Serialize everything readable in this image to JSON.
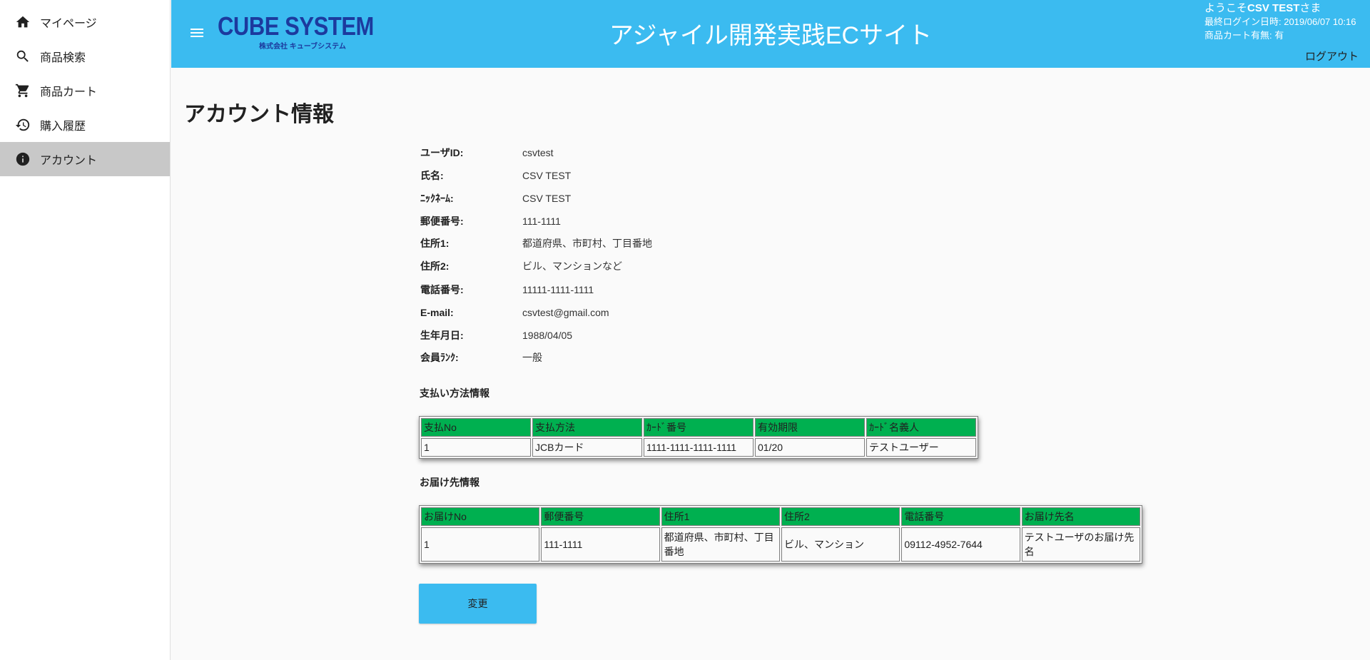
{
  "sidebar": {
    "items": [
      {
        "label": "マイページ",
        "icon": "home-icon"
      },
      {
        "label": "商品検索",
        "icon": "search-icon"
      },
      {
        "label": "商品カート",
        "icon": "cart-icon"
      },
      {
        "label": "購入履歴",
        "icon": "history-icon"
      },
      {
        "label": "アカウント",
        "icon": "info-icon",
        "active": true
      }
    ]
  },
  "header": {
    "logo_text": "CUBE SYSTEM",
    "logo_subtext": "株式会社 キューブシステム",
    "title": "アジャイル開発実践ECサイト",
    "welcome_prefix": "ようこそ",
    "welcome_name": "CSV TEST",
    "welcome_suffix": "さま",
    "last_login": "最終ログイン日時: 2019/06/07 10:16",
    "cart_status": "商品カート有無: 有",
    "logout": "ログアウト",
    "bg_color": "#3bbbf0"
  },
  "page": {
    "title": "アカウント情報"
  },
  "account": {
    "rows": [
      {
        "label": "ユーザID:",
        "value": "csvtest"
      },
      {
        "label": "氏名:",
        "value": "CSV TEST"
      },
      {
        "label": "ﾆｯｸﾈｰﾑ:",
        "value": "CSV TEST"
      },
      {
        "label": "郵便番号:",
        "value": "111-1111"
      },
      {
        "label": "住所1:",
        "value": "都道府県、市町村、丁目番地"
      },
      {
        "label": "住所2:",
        "value": "ビル、マンションなど"
      },
      {
        "label": "電話番号:",
        "value": "11111-1111-1111"
      },
      {
        "label": "E-mail:",
        "value": "csvtest@gmail.com"
      },
      {
        "label": "生年月日:",
        "value": "1988/04/05"
      },
      {
        "label": "会員ﾗﾝｸ:",
        "value": "一般"
      }
    ]
  },
  "payment": {
    "title": "支払い方法情報",
    "headers": [
      "支払No",
      "支払方法",
      "ｶｰﾄﾞ番号",
      "有効期限",
      "ｶｰﾄﾞ名義人"
    ],
    "rows": [
      [
        "1",
        "JCBカード",
        "1111-1111-1111-1111",
        "01/20",
        "テストユーザー"
      ]
    ]
  },
  "delivery": {
    "title": "お届け先情報",
    "headers": [
      "お届けNo",
      "郵便番号",
      "住所1",
      "住所2",
      "電話番号",
      "お届け先名"
    ],
    "rows": [
      [
        "1",
        "111-1111",
        "都道府県、市町村、丁目番地",
        "ビル、マンション",
        "09112-4952-7644",
        "テストユーザのお届け先名"
      ]
    ]
  },
  "actions": {
    "change_label": "変更"
  },
  "colors": {
    "table_header": "#00b050",
    "accent": "#3bbbf0"
  }
}
